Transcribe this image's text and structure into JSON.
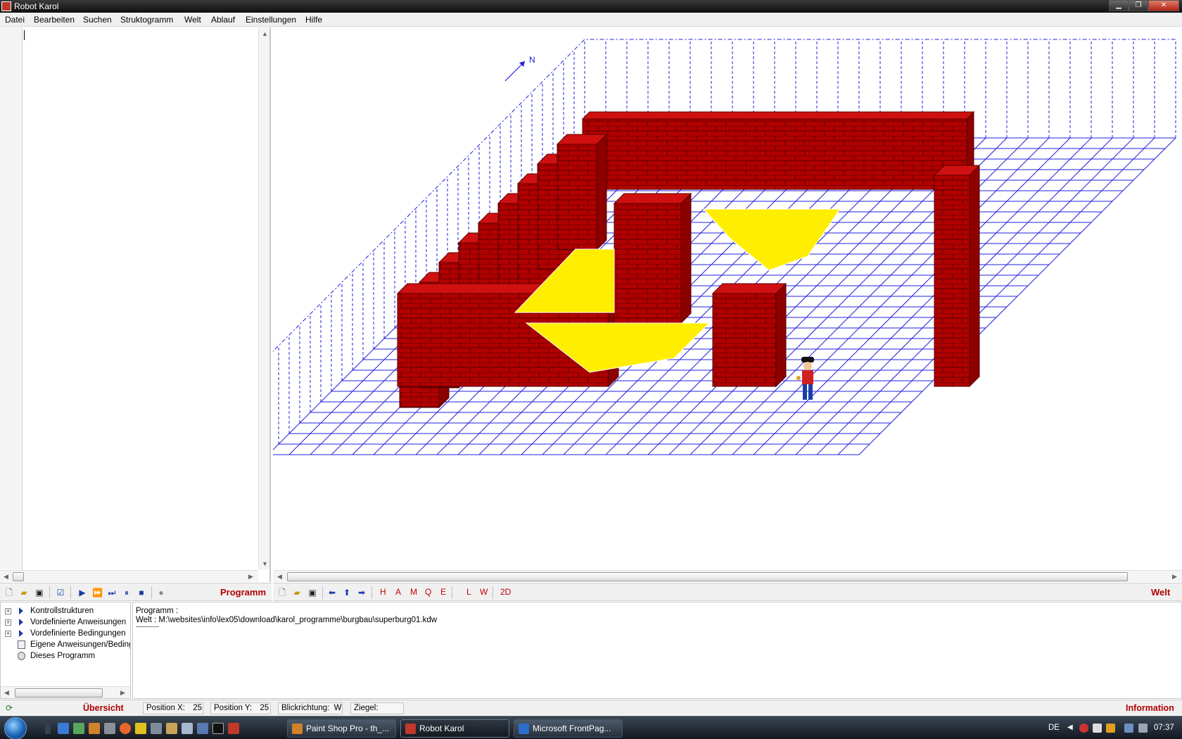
{
  "window": {
    "title": "Robot Karol"
  },
  "menubar": {
    "items": [
      "Datei",
      "Bearbeiten",
      "Suchen",
      "Struktogramm",
      "Welt",
      "Ablauf",
      "Einstellungen",
      "Hilfe"
    ]
  },
  "world_view": {
    "compass_label": "N",
    "colors": {
      "brick": "#b00000",
      "brick_line": "#5a0000",
      "mark": "#ffee00",
      "grid": "#2020e0"
    }
  },
  "program_toolbar": {
    "label": "Programm"
  },
  "world_toolbar": {
    "letters": [
      "H",
      "A",
      "M",
      "Q",
      "E",
      "L",
      "W",
      "2D"
    ],
    "label": "Welt"
  },
  "tree": {
    "items": [
      {
        "label": "Kontrollstrukturen"
      },
      {
        "label": "Vordefinierte Anweisungen"
      },
      {
        "label": "Vordefinierte Bedingungen"
      },
      {
        "label": "Eigene Anweisungen/Bedingungen"
      },
      {
        "label": "Dieses Programm"
      }
    ]
  },
  "output": {
    "program_line": "Programm :",
    "world_line": "Welt : M:\\websites\\info\\lex05\\download\\karol_programme\\burgbau\\superburg01.kdw",
    "divider": "-----------"
  },
  "statusbar": {
    "overview_label": "Übersicht",
    "position_x_label": "Position X:",
    "position_x_value": "25",
    "position_y_label": "Position Y:",
    "position_y_value": "25",
    "direction_label": "Blickrichtung:",
    "direction_value": "W",
    "bricks_label": "Ziegel:",
    "bricks_value": "",
    "info_label": "Information"
  },
  "taskbar": {
    "tasks": [
      {
        "label": "Paint Shop Pro - th_..."
      },
      {
        "label": "Robot Karol"
      },
      {
        "label": "Microsoft FrontPag..."
      }
    ],
    "language": "DE",
    "clock": "07:37"
  }
}
